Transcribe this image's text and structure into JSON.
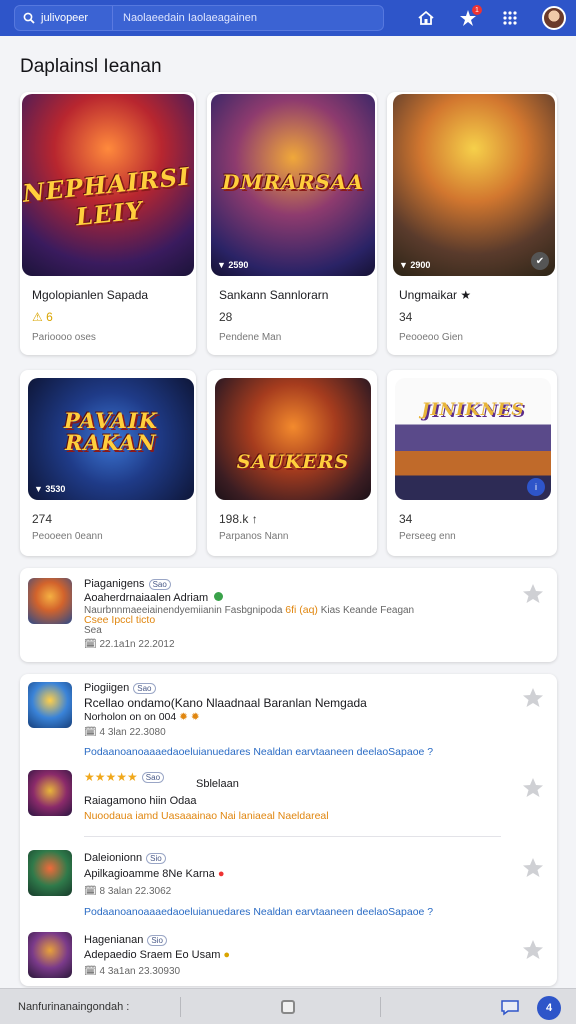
{
  "topbar": {
    "search_scope": "julivopeer",
    "search_text": "Naolaeedain Iaolaeagainen"
  },
  "section_title": "Daplainsl Ieanan",
  "cards": [
    {
      "logo": "NEPHAIRSI LEIY",
      "tag": "",
      "name": "Mgolopianlen Sapada",
      "num": "⚠ 6",
      "sub": "Parioooo oses"
    },
    {
      "logo": "DMRARSAA",
      "tag": "▼ 2590",
      "name": "Sankann Sannlorarn",
      "num": "28",
      "sub": "Pendene Man"
    },
    {
      "logo": "",
      "tag": "▼ 2900",
      "name": "Ungmaikar ★",
      "num": "34",
      "sub": "Peooeoo Gien"
    },
    {
      "logo": "PAVAIK RAKAN",
      "tag": "▼ 3530",
      "name": "",
      "num": "274",
      "sub": "Peooeen 0eann"
    },
    {
      "logo": "SAUKERS",
      "tag": "",
      "name": "",
      "num": "198.k ↑",
      "sub": "Parpanos Nann"
    },
    {
      "logo": "JINIKNES",
      "tag": "",
      "name": "",
      "num": "34",
      "sub": "Perseeg enn"
    }
  ],
  "list_top": {
    "title": "Piaganigens",
    "tag": "Sao",
    "line2": "Aoaherdrnaiaalen Adriam",
    "line3_gray": "Naurbnnmaeeiainendyemiianin Fasbgnipoda",
    "line3_orange": "6fi (aq)",
    "line3_end": "Kias Keande Feagan",
    "line4": "Csee Ipccl ticto",
    "line5": "Sea",
    "date": "🗓 22.1a1n   22.2012"
  },
  "list_rows": [
    {
      "title": "Piogiigen",
      "tag": "Sao",
      "line2": "Rcellao ondamo(Kano Nlaadnaal Baranlan Nemgada",
      "line3": "Norholon on  on 004",
      "date": "🗓 4 3lan   22.3080",
      "link": "Podaanoanoaaaedaoeluianuedares Nealdan earvtaaneen deelaoSapaoe ?"
    },
    {
      "title": "★★★★★",
      "tag": "Sao",
      "line2": "Sblelaan",
      "line3": "Raiagamono hiin Odaa",
      "date": "",
      "link": "Nuoodaua iamd Uasaaainao Nai laniaeal Naeldareal"
    },
    {
      "title": "Daleionionn",
      "tag": "Sio",
      "line2": "Apilkagioamme 8Ne Karna",
      "line3": "",
      "date": "🗓 8 3alan   22.3062",
      "link": "Podaanoanoaaaedaoeluianuedares Nealdan earvtaaneen deelaoSapaoe ?"
    },
    {
      "title": "Hagenianan",
      "tag": "Sio",
      "line2": "Adepaedio Sraem Eo Usam",
      "line3": "",
      "date": "🗓 4 3a1an   23.30930",
      "link": ""
    }
  ],
  "bottombar": {
    "text": "Nanfurinanaingondah :",
    "fab": "4"
  }
}
